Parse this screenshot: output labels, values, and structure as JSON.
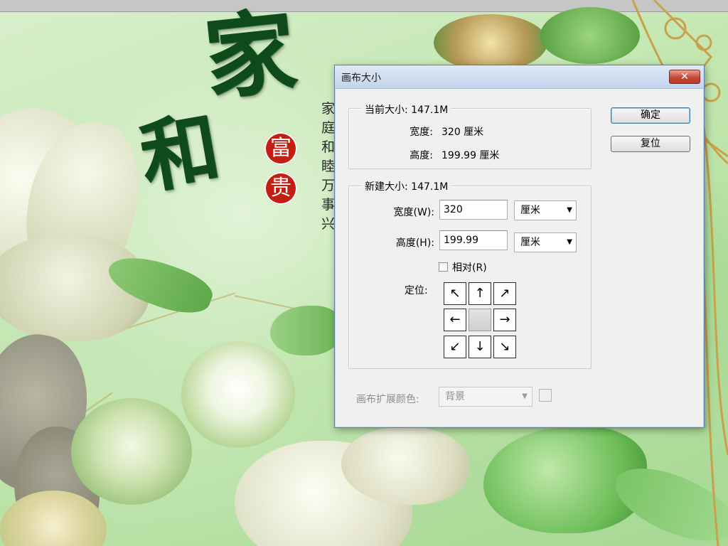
{
  "artwork": {
    "calligraphy_top": "家",
    "calligraphy_bottom": "和",
    "seal_top": "富",
    "seal_bottom": "贵",
    "poem": "家庭和睦万事兴"
  },
  "dialog": {
    "title": "画布大小",
    "close_label": "✕",
    "ok_label": "确定",
    "reset_label": "复位",
    "current_size": {
      "legend": "当前大小: 147.1M",
      "width_label": "宽度:",
      "width_value": "320 厘米",
      "height_label": "高度:",
      "height_value": "199.99 厘米"
    },
    "new_size": {
      "legend": "新建大小: 147.1M",
      "width_label": "宽度(W):",
      "width_value": "320",
      "width_unit": "厘米",
      "height_label": "高度(H):",
      "height_value": "199.99",
      "height_unit": "厘米",
      "relative_label": "相对(R)",
      "relative_checked": false,
      "anchor_label": "定位:",
      "anchor_arrows": [
        "↖",
        "↑",
        "↗",
        "←",
        "",
        "→",
        "↙",
        "↓",
        "↘"
      ]
    },
    "extension_color": {
      "label": "画布扩展颜色:",
      "value": "背景",
      "swatch_color": "#efefef"
    }
  },
  "colors": {
    "titlebar": "#c3d5ec",
    "close_button": "#c54a36",
    "calligraphy": "#0e4a1b",
    "seal": "#c21e12"
  }
}
